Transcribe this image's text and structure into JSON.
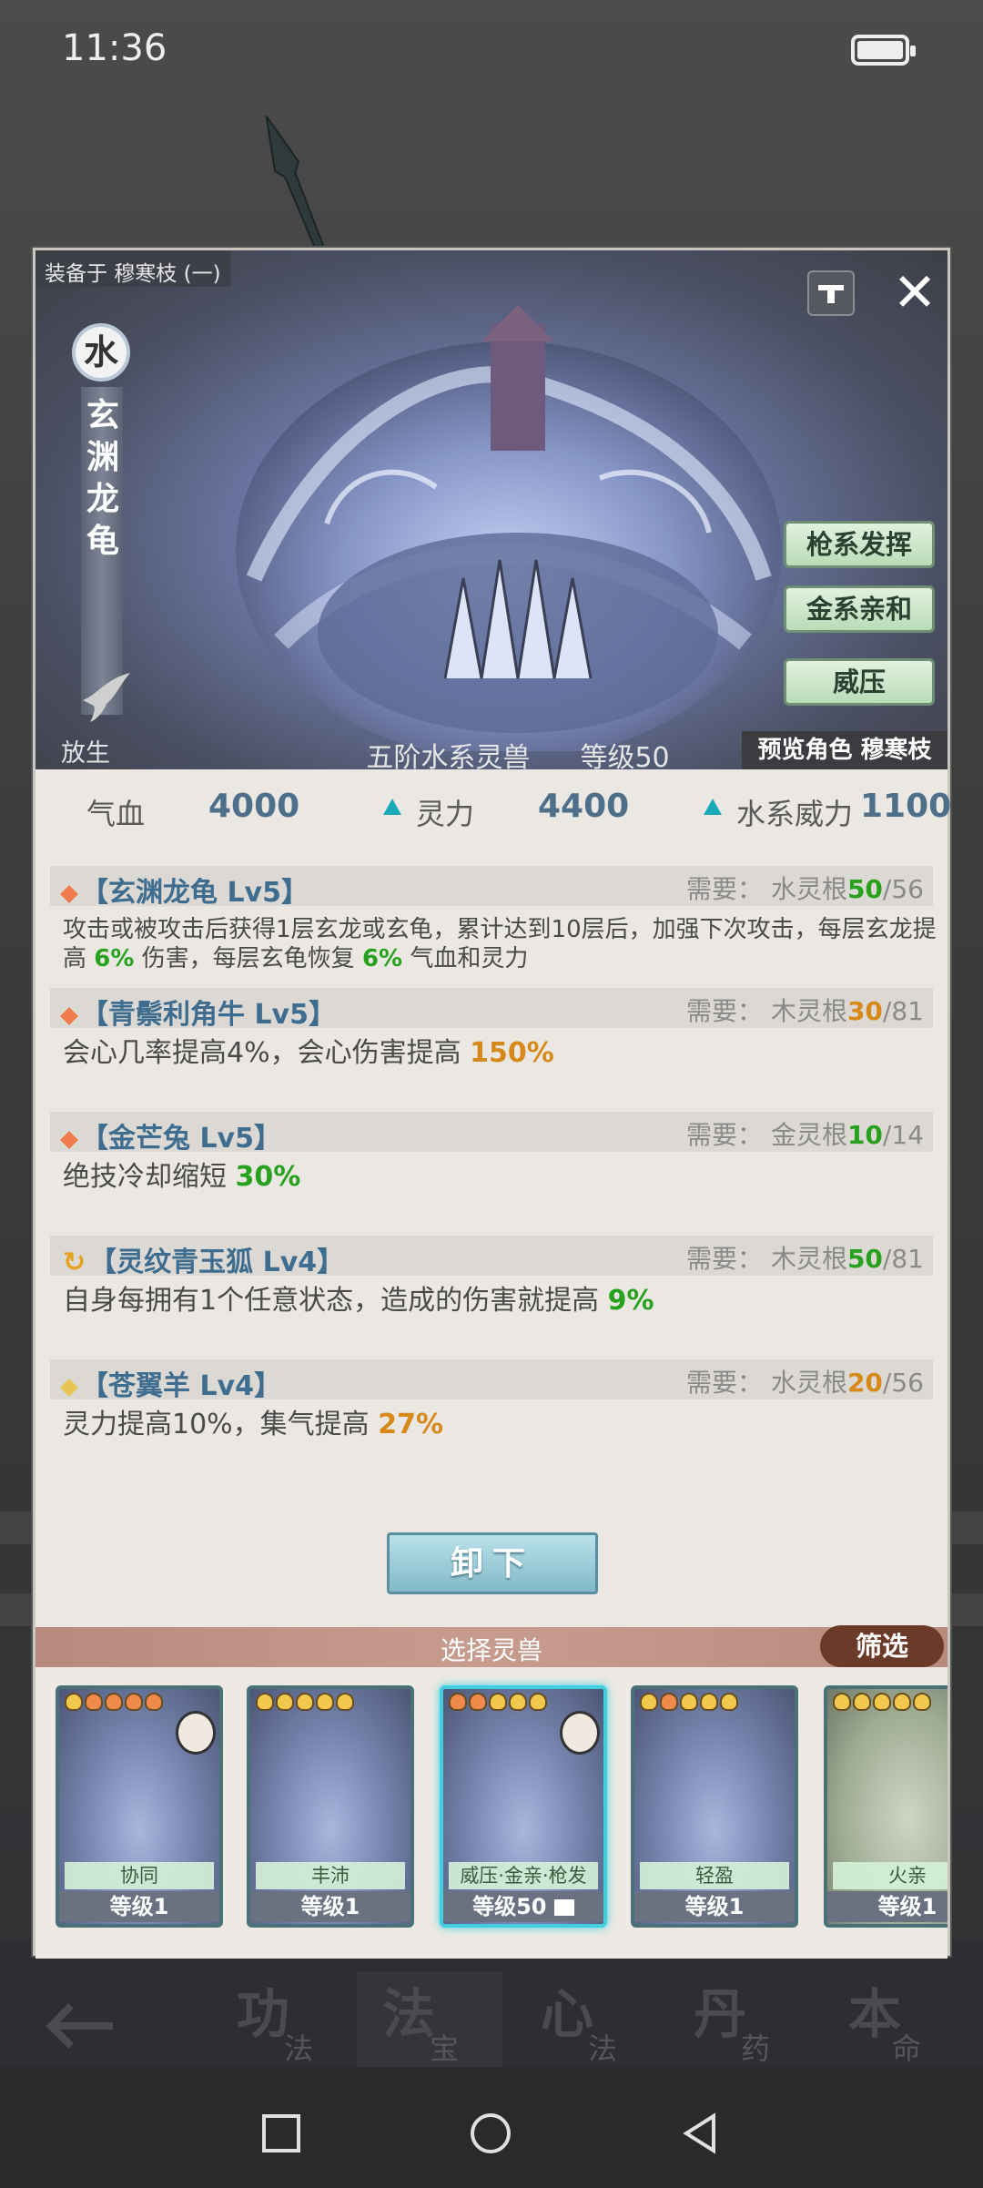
{
  "status_bar": {
    "time": "11:36"
  },
  "modal": {
    "equipped_label": "装备于 穆寒枝 (一)",
    "element": "水",
    "beast_name": "玄渊龙龟",
    "tags": [
      "枪系发挥",
      "金系亲和",
      "威压"
    ],
    "release_label": "放生",
    "tier_text": "五阶水系灵兽",
    "level_text": "等级50",
    "preview_label": "预览角色 穆寒枝",
    "unequip_label": "卸下"
  },
  "stats": [
    {
      "label": "气血",
      "value": "4000"
    },
    {
      "label": "灵力",
      "value": "4400"
    },
    {
      "label": "水系威力",
      "value": "1100"
    }
  ],
  "skills": [
    {
      "name": "【玄渊龙龟 Lv5】",
      "req_label": "需要：",
      "req_root": "水灵根",
      "req_have": "50",
      "req_sep": "/",
      "req_need": "56",
      "desc_parts": [
        "攻击或被攻击后获得1层玄龙或玄龟，累计达到10层后，加强下次攻击，每层玄龙提高 ",
        "6%",
        " 伤害，每层玄龟恢复 ",
        "6%",
        " 气血和灵力"
      ]
    },
    {
      "name": "【青鬃利角牛 Lv5】",
      "req_label": "需要：",
      "req_root": "木灵根",
      "req_have": "30",
      "req_sep": "/",
      "req_need": "81",
      "desc_parts": [
        "会心几率提高4%，会心伤害提高 ",
        "150%"
      ]
    },
    {
      "name": "【金芒兔 Lv5】",
      "req_label": "需要：",
      "req_root": "金灵根",
      "req_have": "10",
      "req_sep": "/",
      "req_need": "14",
      "desc_parts": [
        "绝技冷却缩短 ",
        "30%"
      ]
    },
    {
      "name": "【灵纹青玉狐 Lv4】",
      "req_label": "需要：",
      "req_root": "木灵根",
      "req_have": "50",
      "req_sep": "/",
      "req_need": "81",
      "desc_parts": [
        "自身每拥有1个任意状态，造成的伤害就提高 ",
        "9%"
      ]
    },
    {
      "name": "【苍翼羊 Lv4】",
      "req_label": "需要：",
      "req_root": "水灵根",
      "req_have": "20",
      "req_sep": "/",
      "req_need": "56",
      "desc_parts": [
        "灵力提高10%，集气提高 ",
        "27%"
      ]
    }
  ],
  "picker": {
    "title": "选择灵兽",
    "filter_label": "筛选",
    "cards": [
      {
        "trait": "协同",
        "level": "等级1"
      },
      {
        "trait": "丰沛",
        "level": "等级1"
      },
      {
        "trait": "威压·金亲·枪发",
        "level": "等级50"
      },
      {
        "trait": "轻盈",
        "level": "等级1"
      },
      {
        "trait": "火亲",
        "level": "等级1"
      }
    ]
  },
  "game_tabs": [
    {
      "big": "功",
      "small": "法"
    },
    {
      "big": "法",
      "small": "宝"
    },
    {
      "big": "心",
      "small": "法"
    },
    {
      "big": "丹",
      "small": "药"
    },
    {
      "big": "本",
      "small": "命"
    }
  ],
  "colors": {
    "accent_teal": "#19a9b8",
    "value_green": "#27a11e",
    "value_orange": "#d7891a",
    "skill_blue": "#3e6d8f"
  }
}
